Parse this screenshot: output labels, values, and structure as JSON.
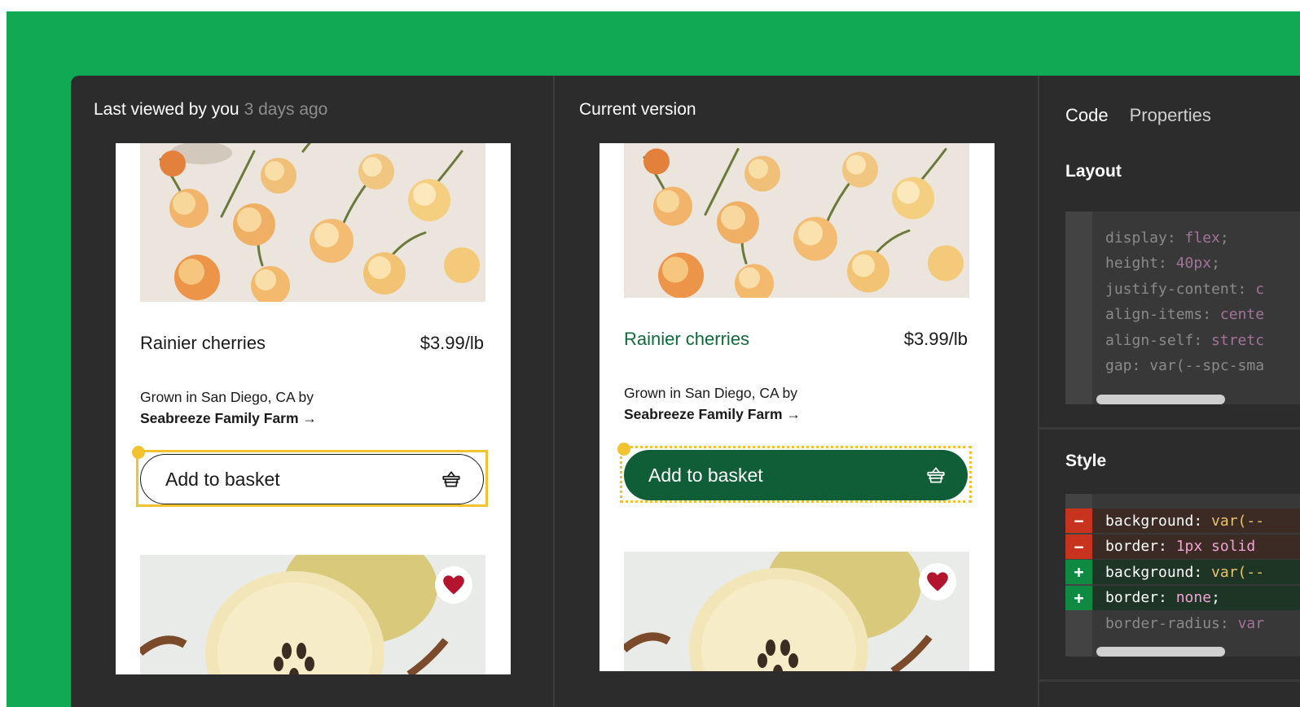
{
  "left_pane": {
    "title": "Last viewed by you",
    "time": "3 days ago",
    "product_name": "Rainier cherries",
    "price": "$3.99/lb",
    "origin": "Grown in San Diego, CA by",
    "farm": "Seabreeze Family Farm",
    "arrow": "→",
    "button_label": "Add to basket"
  },
  "right_pane": {
    "title": "Current version",
    "product_name": "Rainier cherries",
    "price": "$3.99/lb",
    "origin": "Grown in San Diego, CA by",
    "farm": "Seabreeze Family Farm",
    "arrow": "→",
    "button_label": "Add to basket"
  },
  "inspector": {
    "tabs": {
      "code": "Code",
      "properties": "Properties"
    },
    "layout": {
      "title": "Layout",
      "lines": [
        {
          "prop": "display: ",
          "val": "flex",
          "end": ";"
        },
        {
          "prop": "height: ",
          "val": "40px",
          "end": ";"
        },
        {
          "prop": "justify-content: ",
          "val": "c",
          "end": ""
        },
        {
          "prop": "align-items: ",
          "val": "cente",
          "end": ""
        },
        {
          "prop": "align-self: ",
          "val": "stretc",
          "end": ""
        },
        {
          "prop": "gap: ",
          "val": "var(--spc-sma",
          "end": ""
        }
      ]
    },
    "style": {
      "title": "Style",
      "lines": [
        {
          "mark": "−",
          "prop": "background: ",
          "fn": "var(--",
          "val": "",
          "end": ""
        },
        {
          "mark": "−",
          "prop": "border: ",
          "fn": "",
          "val": "1px solid",
          "end": ""
        },
        {
          "mark": "+",
          "prop": "background: ",
          "fn": "var(--",
          "val": "",
          "end": ""
        },
        {
          "mark": "+",
          "prop": "border: ",
          "fn": "",
          "val": "none",
          "end": ";"
        },
        {
          "mark": "",
          "prop": "border-radius: ",
          "fn": "",
          "val": "var",
          "end": ""
        }
      ]
    }
  },
  "colors": {
    "brand_green": "#12a954",
    "button_green": "#0f5e37",
    "selection_yellow": "#f2c230",
    "heart_red": "#b3152f"
  },
  "icons": [
    "basket-icon",
    "heart-icon",
    "arrow-right-icon"
  ]
}
